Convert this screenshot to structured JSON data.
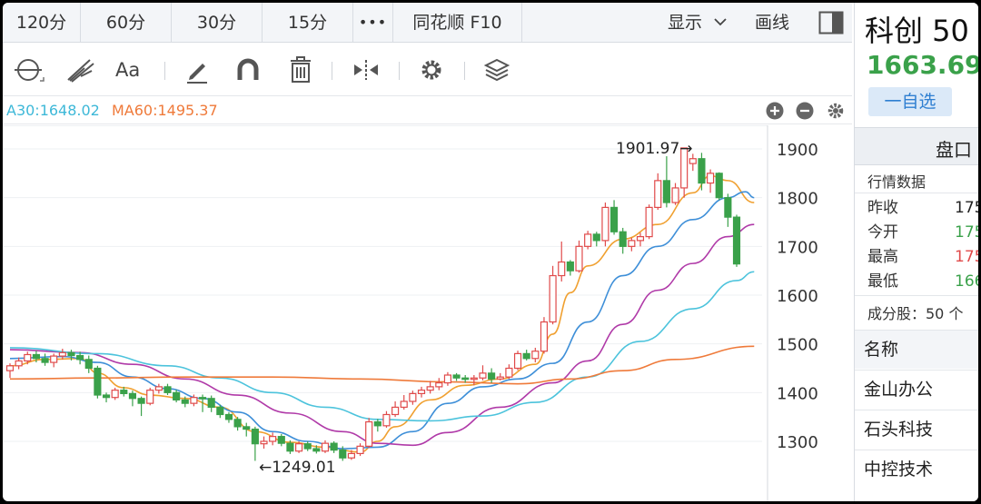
{
  "period_tabs": [
    "120分",
    "60分",
    "30分",
    "15分",
    "•••",
    "同花顺 F10"
  ],
  "period_right": {
    "display_label": "显示",
    "draw_label": "画线"
  },
  "toolbar": {
    "tools": [
      "cycle-icon",
      "fork-icon",
      "text-aa-icon",
      "pen-icon",
      "magnet-icon",
      "trash-icon",
      "flip-icon",
      "gear-icon",
      "layers-icon"
    ],
    "text_tool_label": "Aa"
  },
  "legend": {
    "ma30": "A30:1648.02",
    "ma60": "MA60:1495.37"
  },
  "panel": {
    "stock_name": "科创 50",
    "price": "1663.69",
    "price_arrow": "↓",
    "watch_label": "一自选",
    "pankou_title": "盘口",
    "quote_title": "行情数据",
    "quote_rows": [
      {
        "label": "昨收",
        "value": "175",
        "color": "#222222"
      },
      {
        "label": "今开",
        "value": "175",
        "color": "#3aa14a"
      },
      {
        "label": "最高",
        "value": "175",
        "color": "#e04a4a"
      },
      {
        "label": "最低",
        "value": "166",
        "color": "#3aa14a"
      }
    ],
    "constituents": "成分股：50 个",
    "column_header": "名称",
    "stocks": [
      "金山办公",
      "石头科技",
      "中控技术"
    ]
  },
  "chart_data": {
    "type": "candlestick",
    "y_ticks": [
      1300,
      1400,
      1500,
      1600,
      1700,
      1800,
      1900
    ],
    "ylim": [
      1220,
      1950
    ],
    "annotations": {
      "high": "1901.97→",
      "low": "←1249.01"
    },
    "colors": {
      "up": "#e04a4a",
      "down": "#3aa14a",
      "ma5": "#f0a030",
      "ma10": "#3e8fd8",
      "ma20": "#b03aa8",
      "ma30": "#4cc3dc",
      "ma60": "#ef7a3a"
    },
    "candles": [
      [
        1445,
        1455,
        1430,
        1460
      ],
      [
        1455,
        1465,
        1448,
        1472
      ],
      [
        1465,
        1478,
        1458,
        1484
      ],
      [
        1478,
        1470,
        1462,
        1486
      ],
      [
        1470,
        1462,
        1455,
        1480
      ],
      [
        1462,
        1475,
        1452,
        1480
      ],
      [
        1475,
        1482,
        1468,
        1490
      ],
      [
        1482,
        1476,
        1466,
        1488
      ],
      [
        1476,
        1468,
        1458,
        1484
      ],
      [
        1468,
        1450,
        1440,
        1476
      ],
      [
        1450,
        1395,
        1388,
        1455
      ],
      [
        1395,
        1390,
        1380,
        1400
      ],
      [
        1390,
        1405,
        1385,
        1410
      ],
      [
        1405,
        1398,
        1392,
        1412
      ],
      [
        1398,
        1388,
        1372,
        1404
      ],
      [
        1388,
        1378,
        1352,
        1392
      ],
      [
        1378,
        1405,
        1374,
        1410
      ],
      [
        1405,
        1412,
        1398,
        1418
      ],
      [
        1412,
        1400,
        1395,
        1418
      ],
      [
        1400,
        1385,
        1380,
        1406
      ],
      [
        1385,
        1378,
        1370,
        1392
      ],
      [
        1378,
        1390,
        1372,
        1396
      ],
      [
        1390,
        1388,
        1360,
        1396
      ],
      [
        1388,
        1370,
        1360,
        1394
      ],
      [
        1370,
        1355,
        1348,
        1375
      ],
      [
        1355,
        1345,
        1338,
        1360
      ],
      [
        1345,
        1330,
        1322,
        1350
      ],
      [
        1330,
        1325,
        1310,
        1338
      ],
      [
        1325,
        1295,
        1260,
        1330
      ],
      [
        1295,
        1300,
        1285,
        1310
      ],
      [
        1300,
        1310,
        1292,
        1318
      ],
      [
        1310,
        1296,
        1290,
        1315
      ],
      [
        1296,
        1280,
        1274,
        1302
      ],
      [
        1280,
        1295,
        1276,
        1300
      ],
      [
        1295,
        1285,
        1280,
        1300
      ],
      [
        1285,
        1280,
        1275,
        1292
      ],
      [
        1280,
        1296,
        1276,
        1302
      ],
      [
        1296,
        1282,
        1276,
        1300
      ],
      [
        1282,
        1266,
        1260,
        1290
      ],
      [
        1266,
        1275,
        1262,
        1282
      ],
      [
        1275,
        1290,
        1270,
        1296
      ],
      [
        1290,
        1340,
        1286,
        1348
      ],
      [
        1340,
        1332,
        1320,
        1346
      ],
      [
        1332,
        1355,
        1328,
        1362
      ],
      [
        1355,
        1370,
        1350,
        1382
      ],
      [
        1370,
        1382,
        1365,
        1395
      ],
      [
        1382,
        1398,
        1375,
        1404
      ],
      [
        1398,
        1405,
        1390,
        1412
      ],
      [
        1405,
        1412,
        1398,
        1424
      ],
      [
        1412,
        1420,
        1405,
        1430
      ],
      [
        1420,
        1436,
        1414,
        1442
      ],
      [
        1436,
        1430,
        1424,
        1440
      ],
      [
        1430,
        1428,
        1420,
        1436
      ],
      [
        1428,
        1430,
        1415,
        1436
      ],
      [
        1430,
        1440,
        1425,
        1456
      ],
      [
        1440,
        1428,
        1420,
        1450
      ],
      [
        1428,
        1432,
        1425,
        1440
      ],
      [
        1432,
        1450,
        1428,
        1458
      ],
      [
        1450,
        1480,
        1446,
        1486
      ],
      [
        1480,
        1470,
        1466,
        1488
      ],
      [
        1470,
        1485,
        1462,
        1492
      ],
      [
        1485,
        1545,
        1480,
        1555
      ],
      [
        1545,
        1640,
        1540,
        1660
      ],
      [
        1640,
        1668,
        1628,
        1710
      ],
      [
        1668,
        1650,
        1640,
        1672
      ],
      [
        1650,
        1700,
        1646,
        1712
      ],
      [
        1700,
        1725,
        1694,
        1732
      ],
      [
        1725,
        1712,
        1700,
        1730
      ],
      [
        1712,
        1780,
        1700,
        1790
      ],
      [
        1780,
        1730,
        1724,
        1795
      ],
      [
        1730,
        1700,
        1685,
        1738
      ],
      [
        1700,
        1712,
        1690,
        1718
      ],
      [
        1712,
        1720,
        1700,
        1728
      ],
      [
        1720,
        1780,
        1715,
        1786
      ],
      [
        1780,
        1835,
        1775,
        1850
      ],
      [
        1835,
        1790,
        1780,
        1885
      ],
      [
        1790,
        1820,
        1785,
        1830
      ],
      [
        1820,
        1902,
        1800,
        1902
      ],
      [
        1870,
        1880,
        1855,
        1890
      ],
      [
        1880,
        1830,
        1815,
        1892
      ],
      [
        1830,
        1850,
        1810,
        1858
      ],
      [
        1850,
        1800,
        1795,
        1852
      ],
      [
        1800,
        1760,
        1740,
        1808
      ],
      [
        1760,
        1664,
        1658,
        1765
      ]
    ],
    "ma_series": {
      "ma5": [
        [
          0,
          1455
        ],
        [
          4,
          1468
        ],
        [
          8,
          1470
        ],
        [
          10,
          1440
        ],
        [
          13,
          1410
        ],
        [
          16,
          1395
        ],
        [
          20,
          1388
        ],
        [
          24,
          1370
        ],
        [
          28,
          1320
        ],
        [
          32,
          1298
        ],
        [
          36,
          1288
        ],
        [
          40,
          1278
        ],
        [
          42,
          1300
        ],
        [
          44,
          1330
        ],
        [
          48,
          1385
        ],
        [
          52,
          1415
        ],
        [
          56,
          1428
        ],
        [
          60,
          1458
        ],
        [
          62,
          1520
        ],
        [
          64,
          1605
        ],
        [
          66,
          1660
        ],
        [
          70,
          1715
        ],
        [
          74,
          1745
        ],
        [
          78,
          1810
        ],
        [
          80,
          1845
        ],
        [
          82,
          1835
        ],
        [
          85,
          1790
        ]
      ],
      "ma10": [
        [
          0,
          1470
        ],
        [
          6,
          1474
        ],
        [
          10,
          1462
        ],
        [
          14,
          1432
        ],
        [
          18,
          1408
        ],
        [
          22,
          1388
        ],
        [
          26,
          1360
        ],
        [
          30,
          1320
        ],
        [
          34,
          1300
        ],
        [
          38,
          1285
        ],
        [
          42,
          1288
        ],
        [
          46,
          1320
        ],
        [
          50,
          1378
        ],
        [
          54,
          1412
        ],
        [
          58,
          1428
        ],
        [
          62,
          1460
        ],
        [
          66,
          1545
        ],
        [
          70,
          1640
        ],
        [
          74,
          1700
        ],
        [
          78,
          1755
        ],
        [
          82,
          1800
        ],
        [
          84,
          1812
        ],
        [
          85,
          1800
        ]
      ],
      "ma20": [
        [
          0,
          1488
        ],
        [
          8,
          1482
        ],
        [
          14,
          1458
        ],
        [
          20,
          1428
        ],
        [
          26,
          1395
        ],
        [
          32,
          1358
        ],
        [
          38,
          1320
        ],
        [
          42,
          1296
        ],
        [
          46,
          1292
        ],
        [
          50,
          1318
        ],
        [
          56,
          1370
        ],
        [
          62,
          1420
        ],
        [
          66,
          1465
        ],
        [
          70,
          1540
        ],
        [
          74,
          1610
        ],
        [
          78,
          1665
        ],
        [
          82,
          1720
        ],
        [
          85,
          1745
        ]
      ],
      "ma30": [
        [
          0,
          1492
        ],
        [
          10,
          1480
        ],
        [
          18,
          1455
        ],
        [
          24,
          1430
        ],
        [
          30,
          1400
        ],
        [
          36,
          1370
        ],
        [
          42,
          1345
        ],
        [
          48,
          1342
        ],
        [
          54,
          1352
        ],
        [
          60,
          1380
        ],
        [
          66,
          1432
        ],
        [
          72,
          1505
        ],
        [
          78,
          1572
        ],
        [
          83,
          1630
        ],
        [
          85,
          1648
        ]
      ],
      "ma60": [
        [
          0,
          1428
        ],
        [
          10,
          1430
        ],
        [
          20,
          1432
        ],
        [
          30,
          1432
        ],
        [
          40,
          1428
        ],
        [
          50,
          1422
        ],
        [
          58,
          1418
        ],
        [
          64,
          1428
        ],
        [
          70,
          1445
        ],
        [
          76,
          1468
        ],
        [
          85,
          1495
        ]
      ]
    }
  }
}
